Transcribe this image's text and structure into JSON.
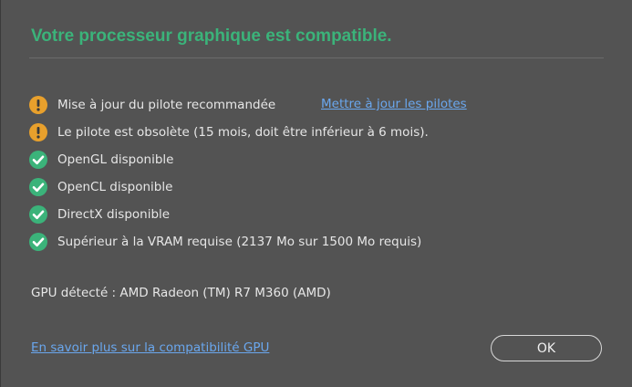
{
  "dialog": {
    "title": "Votre processeur graphique est compatible.",
    "checks": [
      {
        "status": "warning",
        "icon": "warning-icon",
        "label": "Mise à jour du pilote recommandée"
      },
      {
        "status": "warning",
        "icon": "warning-icon",
        "label": "Le pilote est obsolète (15 mois, doit être inférieur à 6 mois)."
      },
      {
        "status": "ok",
        "icon": "checkmark-icon",
        "label": "OpenGL disponible"
      },
      {
        "status": "ok",
        "icon": "checkmark-icon",
        "label": "OpenCL disponible"
      },
      {
        "status": "ok",
        "icon": "checkmark-icon",
        "label": "DirectX disponible"
      },
      {
        "status": "ok",
        "icon": "checkmark-icon",
        "label": "Supérieur à la VRAM requise (2137 Mo sur 1500 Mo requis)"
      }
    ],
    "update_drivers_link": "Mettre à jour les pilotes",
    "gpu_detected": "GPU détecté : AMD Radeon (TM) R7 M360 (AMD)",
    "learn_more_link": "En savoir plus sur la compatibilité GPU",
    "ok_label": "OK"
  },
  "colors": {
    "background": "#535353",
    "title_green": "#3bb37a",
    "warning_orange": "#e8a02c",
    "ok_green": "#3bb37a",
    "link_blue": "#6aa7ee"
  }
}
